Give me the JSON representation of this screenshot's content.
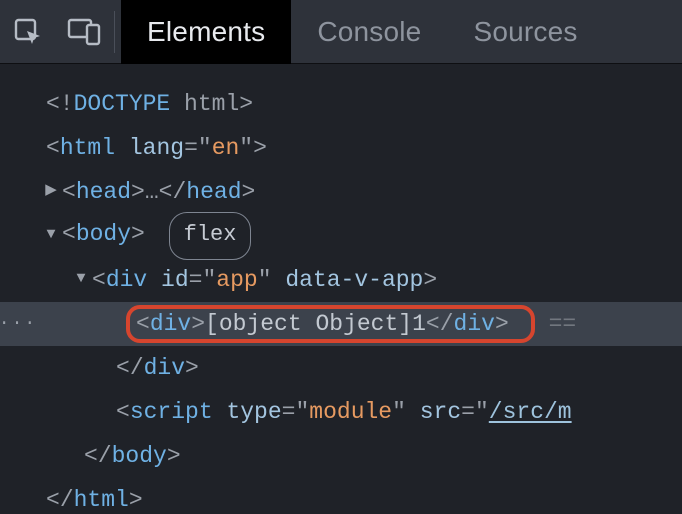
{
  "tabs": {
    "elements": "Elements",
    "console": "Console",
    "sources": "Sources"
  },
  "gutter": "···",
  "pill_flex": "flex",
  "trail_eq": "==",
  "dom": {
    "doctype_open": "<!",
    "doctype_word": "DOCTYPE",
    "doctype_space_html": " html",
    "doctype_close": ">",
    "lt": "<",
    "gt": ">",
    "slash": "/",
    "eq": "=",
    "q": "\"",
    "dots": "…",
    "html": "html",
    "head": "head",
    "body": "body",
    "div": "div",
    "script": "script",
    "attr_lang": "lang",
    "val_en": "en",
    "attr_id": "id",
    "val_app": "app",
    "attr_datavapp": "data-v-app",
    "text_obj": "[object Object]1",
    "attr_type": "type",
    "val_module": "module",
    "attr_src": "src",
    "val_srcm": "/src/m"
  }
}
